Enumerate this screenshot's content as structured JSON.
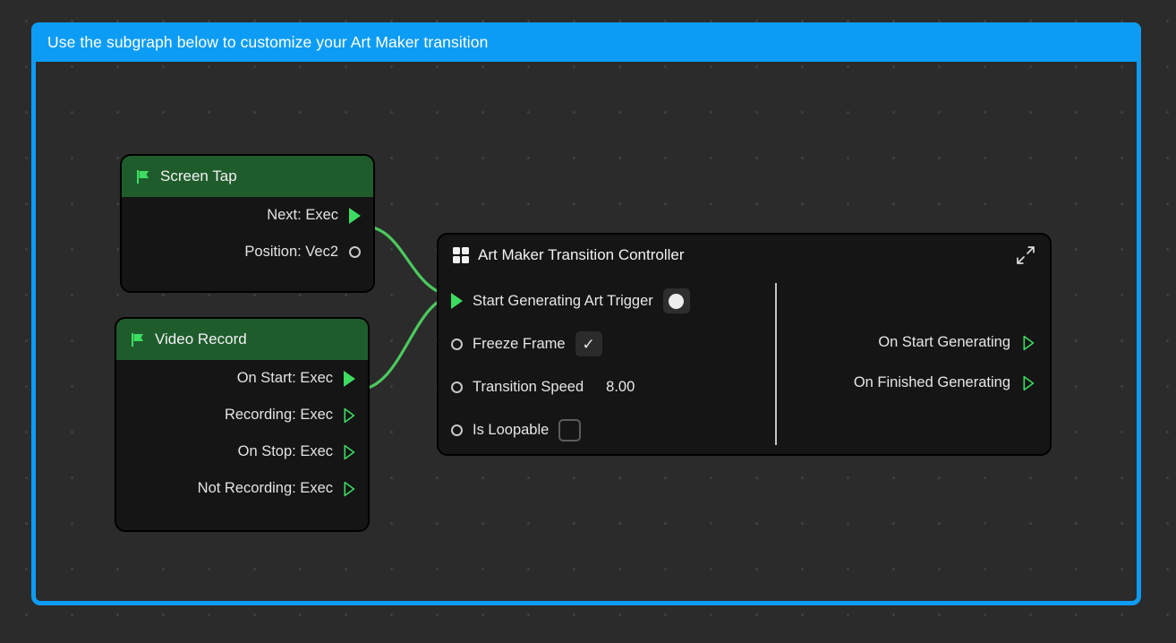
{
  "subgraph": {
    "banner_text": "Use the subgraph below to customize your Art Maker transition",
    "accent_color": "#0d9cf5"
  },
  "canvas": {
    "background_color": "#2b2b2b",
    "dot_color": "#3f3f3f"
  },
  "nodes": [
    {
      "id": "screen-tap",
      "title": "Screen Tap",
      "header_icon": "flag-icon",
      "header_color": "#1f5c2c",
      "outputs": [
        {
          "label": "Next: Exec",
          "port": "exec-filled-triangle",
          "connected": true
        },
        {
          "label": "Position: Vec2",
          "port": "data-circle",
          "connected": false
        }
      ]
    },
    {
      "id": "video-record",
      "title": "Video Record",
      "header_icon": "flag-icon",
      "header_color": "#1f5c2c",
      "outputs": [
        {
          "label": "On Start: Exec",
          "port": "exec-filled-triangle",
          "connected": true
        },
        {
          "label": "Recording: Exec",
          "port": "exec-outline-triangle",
          "connected": false
        },
        {
          "label": "On Stop: Exec",
          "port": "exec-outline-triangle",
          "connected": false
        },
        {
          "label": "Not Recording: Exec",
          "port": "exec-outline-triangle",
          "connected": false
        }
      ]
    },
    {
      "id": "controller",
      "title": "Art Maker Transition Controller",
      "header_icon": "grid-icon",
      "header_action_icon": "expand-icon",
      "inputs": [
        {
          "label": "Start Generating Art Trigger",
          "port": "exec-filled-triangle",
          "widget": "pulse-button",
          "value": ""
        },
        {
          "label": "Freeze Frame",
          "port": "data-circle",
          "widget": "checkbox-checked",
          "value": "✓"
        },
        {
          "label": "Transition Speed",
          "port": "data-circle",
          "widget": "number",
          "value": "8.00"
        },
        {
          "label": "Is Loopable",
          "port": "data-circle",
          "widget": "checkbox-unchecked",
          "value": ""
        }
      ],
      "outputs": [
        {
          "label": "On Start Generating",
          "port": "exec-outline-triangle",
          "connected": false
        },
        {
          "label": "On Finished Generating",
          "port": "exec-outline-triangle",
          "connected": false
        }
      ]
    }
  ],
  "connections": [
    {
      "from": "screen-tap.Next: Exec",
      "to": "controller.Start Generating Art Trigger",
      "color": "#4cc95e"
    },
    {
      "from": "video-record.On Start: Exec",
      "to": "controller.Start Generating Art Trigger",
      "color": "#4cc95e"
    }
  ]
}
